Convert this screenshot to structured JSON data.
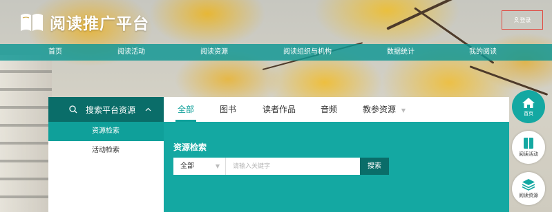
{
  "header": {
    "logo_text": "阅读推广平台",
    "login_label": "登录"
  },
  "nav": {
    "items": [
      "首页",
      "阅读活动",
      "阅读资源",
      "阅读组织与机构",
      "数据统计",
      "我的阅读"
    ]
  },
  "search_panel": {
    "header_label": "搜索平台资源",
    "menu": [
      {
        "label": "资源检索",
        "active": true
      },
      {
        "label": "活动检索",
        "active": false
      }
    ],
    "tabs": [
      {
        "label": "全部",
        "active": true
      },
      {
        "label": "图书",
        "active": false
      },
      {
        "label": "读者作品",
        "active": false
      },
      {
        "label": "音频",
        "active": false
      },
      {
        "label": "教参资源",
        "active": false,
        "has_dropdown": true
      }
    ],
    "body_title": "资源检索",
    "select_value": "全部",
    "input_placeholder": "请输入关键字",
    "search_button": "搜索"
  },
  "floating_buttons": [
    {
      "label": "首页",
      "icon": "home-icon"
    },
    {
      "label": "阅读活动",
      "icon": "book-icon"
    },
    {
      "label": "阅读资源",
      "icon": "layers-icon"
    }
  ],
  "colors": {
    "teal": "#14a8a2",
    "dark_teal": "#0a6d69",
    "login_border": "#e0483f"
  }
}
